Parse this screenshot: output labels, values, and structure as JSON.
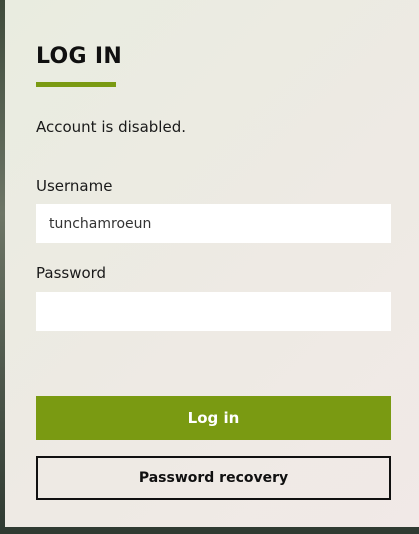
{
  "login": {
    "title": "LOG IN",
    "message": "Account is disabled.",
    "username_label": "Username",
    "username_value": "tunchamroeun",
    "password_label": "Password",
    "password_value": "",
    "login_button": "Log in",
    "recovery_button": "Password recovery"
  },
  "colors": {
    "accent": "#7a9a12",
    "text": "#101010",
    "card_background": "#eeeae4"
  }
}
